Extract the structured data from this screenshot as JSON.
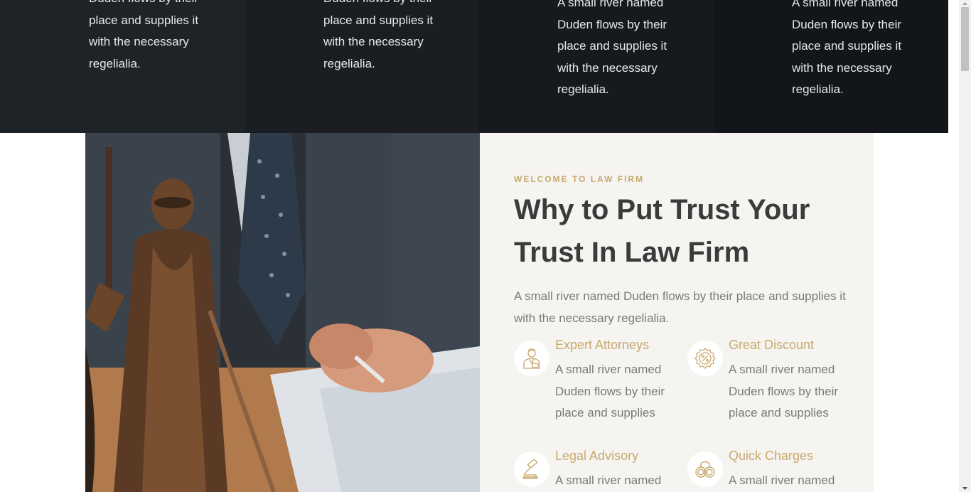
{
  "services": [
    {
      "text": "Duden flows by their place and supplies it with the necessary regelialia."
    },
    {
      "text": "Duden flows by their place and supplies it with the necessary regelialia."
    },
    {
      "text": "A small river named Duden flows by their place and supplies it with the necessary regelialia."
    },
    {
      "text": "A small river named Duden flows by their place and supplies it with the necessary regelialia."
    }
  ],
  "about": {
    "eyebrow": "WELCOME TO LAW FIRM",
    "title": "Why to Put Trust Your Trust In Law Firm",
    "description": "A small river named Duden flows by their place and supplies it with the necessary regelialia.",
    "features": [
      {
        "title": "Expert Attorneys",
        "text": "A small river named Duden flows by their place and supplies",
        "icon": "attorney-icon"
      },
      {
        "title": "Great Discount",
        "text": "A small river named Duden flows by their place and supplies",
        "icon": "discount-badge-icon"
      },
      {
        "title": "Legal Advisory",
        "text": "A small river named",
        "icon": "gavel-icon"
      },
      {
        "title": "Quick Charges",
        "text": "A small river named",
        "icon": "handcuffs-icon"
      }
    ]
  },
  "colors": {
    "accent": "#c9a96e",
    "heading": "#3b3b3b",
    "body_text": "#7a7a7a",
    "panel_bg": "#f5f4f1",
    "dark_band": "#1a1e22"
  }
}
